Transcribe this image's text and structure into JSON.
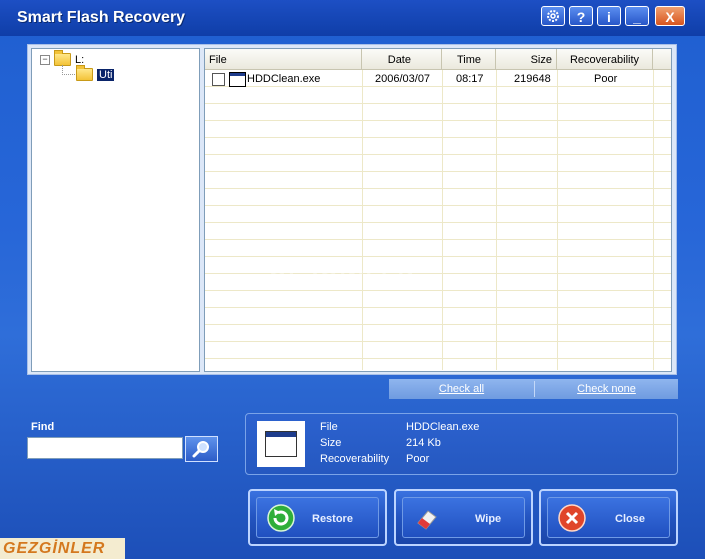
{
  "app": {
    "title": "Smart Flash Recovery"
  },
  "titlebar_buttons": [
    {
      "name": "settings",
      "icon": "gear-icon"
    },
    {
      "name": "help",
      "label": "?"
    },
    {
      "name": "info",
      "label": "i"
    },
    {
      "name": "minimize",
      "label": "_"
    },
    {
      "name": "close",
      "label": "X"
    }
  ],
  "tree": {
    "root": {
      "label": "L:",
      "expander": "−"
    },
    "child": {
      "label": "Uti"
    }
  },
  "list": {
    "columns": [
      "File",
      "Date",
      "Time",
      "Size",
      "Recoverability"
    ],
    "rows": [
      {
        "file": "HDDClean.exe",
        "date": "2006/03/07",
        "time": "08:17",
        "size": "219648",
        "recoverability": "Poor",
        "checked": false
      }
    ]
  },
  "links": {
    "check_all": "Check all",
    "check_none": "Check none"
  },
  "find": {
    "label": "Find",
    "value": ""
  },
  "info": {
    "file_label": "File",
    "file_value": "HDDClean.exe",
    "size_label": "Size",
    "size_value": "214 Kb",
    "recov_label": "Recoverability",
    "recov_value": "Poor"
  },
  "buttons": {
    "restore": "Restore",
    "wipe": "Wipe",
    "close": "Close"
  },
  "watermark": {
    "center": "GEZGİNLER",
    "corner": "GEZGİNLER"
  },
  "colors": {
    "window_blue": "#2766d8",
    "close_orange": "#d8551e",
    "selection": "#0a246a"
  }
}
